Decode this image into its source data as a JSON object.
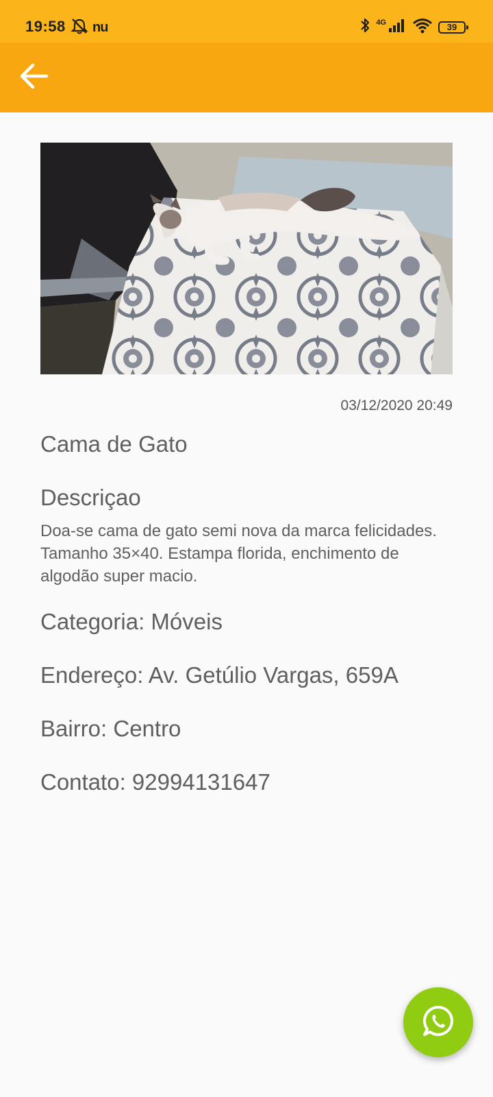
{
  "status_bar": {
    "time": "19:58",
    "carrier_logo": "nu",
    "network": "4G",
    "battery": "39",
    "icons": [
      "mute-notification-icon",
      "bluetooth-icon",
      "signal-icon",
      "wifi-icon",
      "battery-icon"
    ]
  },
  "app_bar": {
    "back_icon": "arrow-left-icon",
    "color": "#f9a711"
  },
  "listing": {
    "date": "03/12/2020 20:49",
    "title": "Cama de Gato",
    "description_header": "Descriçao",
    "description": "Doa-se cama de gato semi nova da marca felicidades. Tamanho 35×40. Estampa florida, enchimento de algodão super macio.",
    "category": "Categoria: Móveis",
    "address": "Endereço: Av. Getúlio Vargas, 659A",
    "neighborhood": "Bairro: Centro",
    "contact": "Contato: 92994131647"
  },
  "fab": {
    "icon": "whatsapp-icon",
    "color": "#8fcc12"
  }
}
